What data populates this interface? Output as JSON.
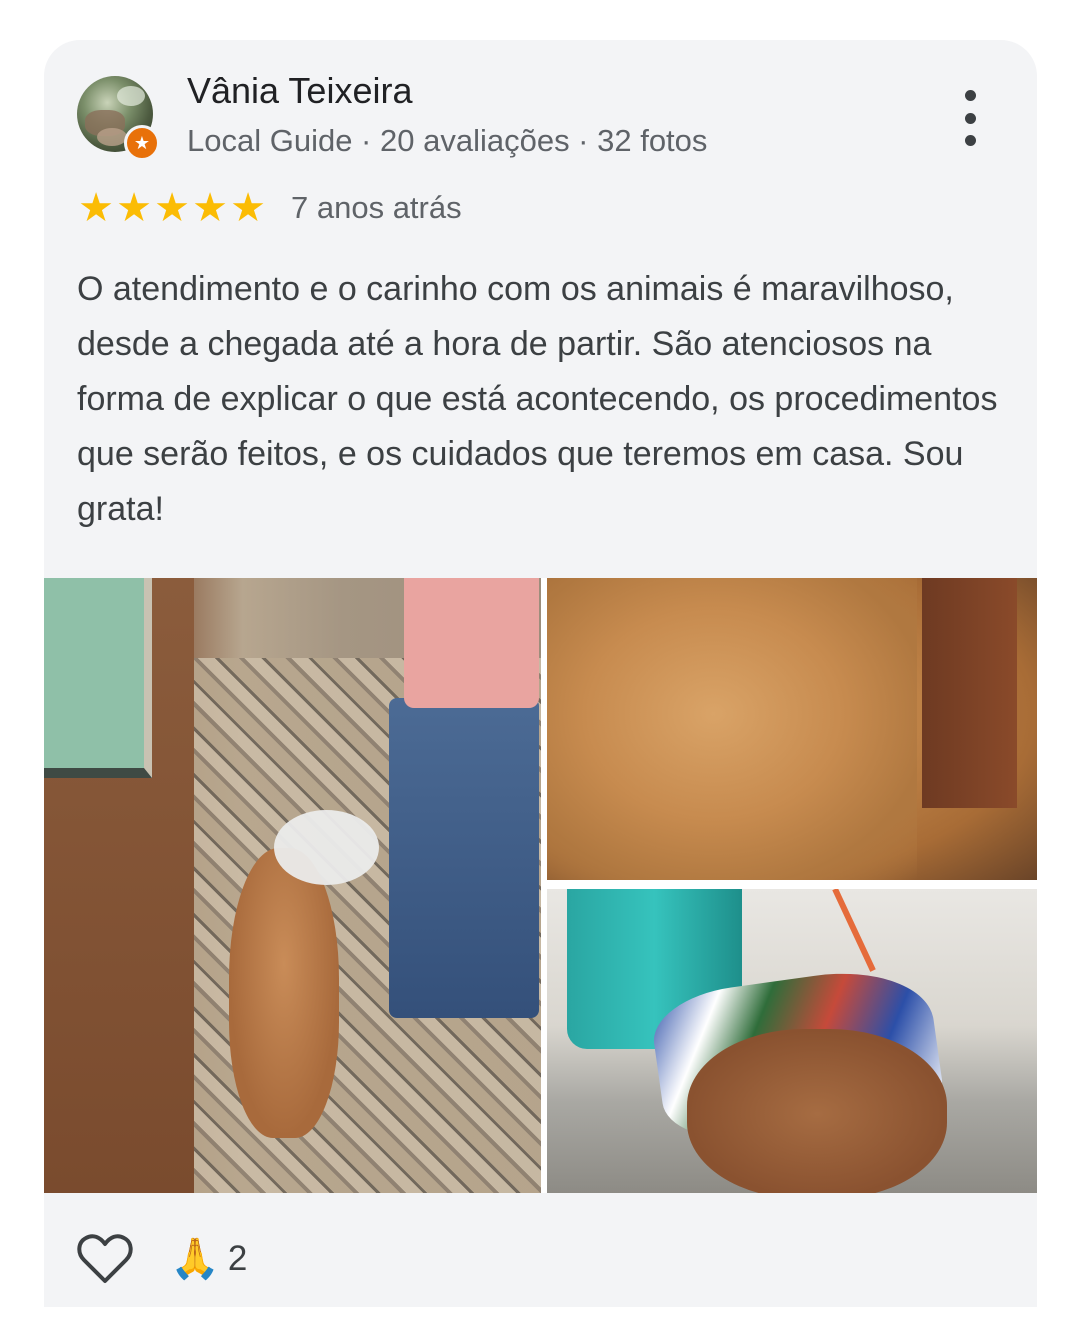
{
  "review": {
    "author": {
      "name": "Vânia Teixeira",
      "meta": "Local Guide · 20 avaliações · 32 fotos",
      "avatar_icon": "profile-photo",
      "badge_icon": "local-guide-star-icon",
      "badge_color": "#e8710a"
    },
    "rating": {
      "stars": 5,
      "max_stars": 5,
      "star_color": "#fbbc04",
      "time_ago": "7 anos atrás"
    },
    "text": "O atendimento e o carinho com os animais é maravilhoso, desde a chegada até a hora de partir. São atenciosos na forma de explicar o que está acontecendo, os procedimentos que serão feitos, e os cuidados que teremos em casa. Sou grata!",
    "photos": [
      {
        "subject": "dog-walking-on-leash"
      },
      {
        "subject": "dog-closeup"
      },
      {
        "subject": "dog-on-blanket"
      }
    ],
    "footer": {
      "like_icon": "heart-outline-icon",
      "reaction_icon": "🙏",
      "reaction_count": "2"
    },
    "menu_icon": "more-vertical-icon"
  }
}
